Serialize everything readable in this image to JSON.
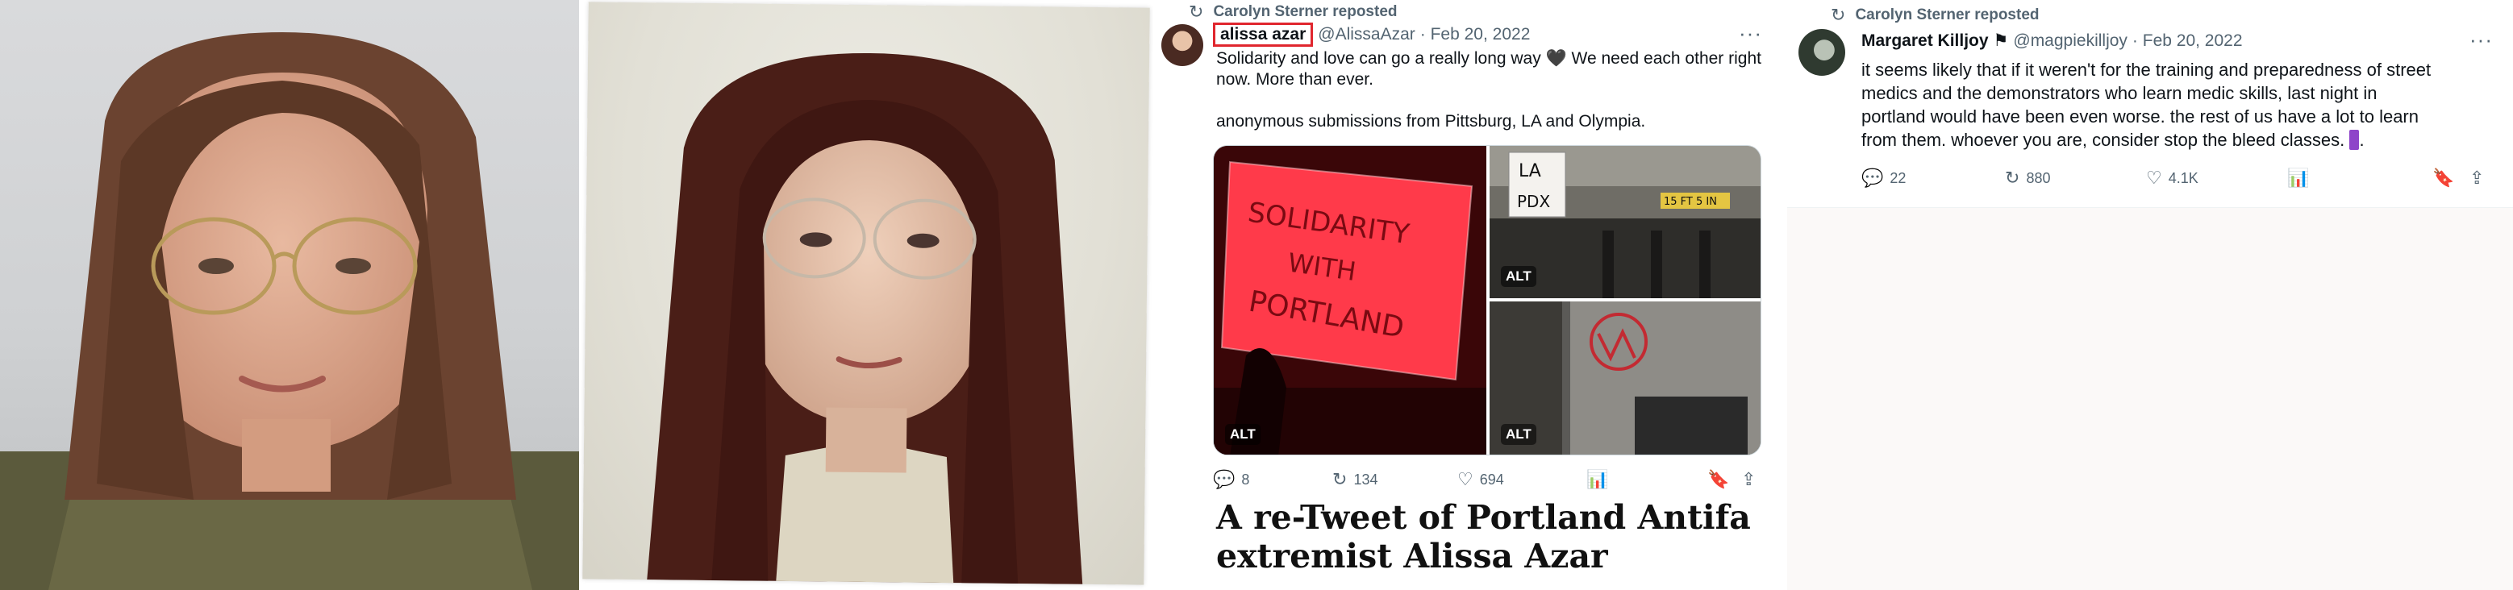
{
  "tweet1": {
    "repost_label": "Carolyn Sterner reposted",
    "display_name": "alissa azar",
    "handle": "@AlissaAzar",
    "date": "· Feb 20, 2022",
    "more": "···",
    "text_line1": "Solidarity and love can go a really long way 🖤 We need each other right",
    "text_line2": "now. More than ever.",
    "text_line3": "anonymous submissions from Pittsburg, LA and Olympia.",
    "media": {
      "alt_badge": "ALT",
      "banner_text": [
        "SOLIDARITY",
        "WITH",
        "PORTLAND"
      ],
      "sign_text": [
        "LA",
        "PDX"
      ],
      "bridge_sign": "15 FT 5 IN"
    },
    "actions": {
      "replies": "8",
      "reposts": "134",
      "likes": "694"
    },
    "caption": "A re-Tweet of Portland Antifa extremist Alissa Azar"
  },
  "tweet2": {
    "repost_label": "Carolyn Sterner reposted",
    "display_name": "Margaret Killjoy",
    "flag": "⚑",
    "handle": "@magpiekilljoy",
    "date": "· Feb 20, 2022",
    "more": "···",
    "text_line1": "it seems likely that if it weren't for the training and preparedness of street",
    "text_line2": "medics and the demonstrators who learn medic skills, last night in",
    "text_line3": "portland would have been even worse. the rest of us have a lot to learn",
    "text_line4": "from them. whoever you are, consider stop the bleed classes.",
    "emoji_placeholder": "▮",
    "text_end": ".",
    "actions": {
      "replies": "22",
      "reposts": "880",
      "likes": "4.1K"
    }
  },
  "icons": {
    "repost": "↻",
    "reply": "💬",
    "like": "♡",
    "views": "📊",
    "bookmark": "🔖",
    "share": "⇪"
  },
  "colors": {
    "highlight_box": "#e0262e",
    "muted": "#536471",
    "emoji_purple": "#8e44c9"
  }
}
